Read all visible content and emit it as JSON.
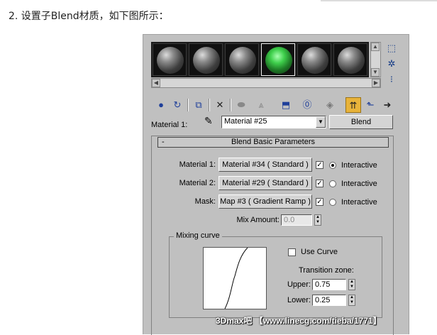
{
  "heading": "2. 设置子Blend材质，如下图所示：",
  "material_slots": [
    {
      "id": 1,
      "selected": false,
      "color": "gray"
    },
    {
      "id": 2,
      "selected": false,
      "color": "gray"
    },
    {
      "id": 3,
      "selected": false,
      "color": "gray"
    },
    {
      "id": 4,
      "selected": true,
      "color": "green"
    },
    {
      "id": 5,
      "selected": false,
      "color": "gray"
    },
    {
      "id": 6,
      "selected": false,
      "color": "gray"
    }
  ],
  "side_icons": [
    "sample-type-icon",
    "backlight-icon",
    "sample-uv-tiling-icon"
  ],
  "toolbar": {
    "buttons": [
      "get-material-icon",
      "put-material-icon",
      "assign-material-icon",
      "delete-icon",
      "copy-material-icon",
      "make-unique-icon",
      "put-to-library-icon",
      "material-id-channel-icon",
      "show-map-icon",
      "show-end-result-icon",
      "go-to-parent-icon",
      "go-forward-sibling-icon"
    ],
    "active": "show-end-result-icon"
  },
  "material_row": {
    "label": "Material 1:",
    "material_name": "Material #25",
    "type_button": "Blend"
  },
  "rollout": {
    "collapse_symbol": "-",
    "title": "Blend Basic Parameters",
    "rows": [
      {
        "label": "Material 1:",
        "button": "Material #34  ( Standard )",
        "checked": true,
        "interactive_selected": true,
        "interactive_label": "Interactive"
      },
      {
        "label": "Material 2:",
        "button": "Material #29  ( Standard )",
        "checked": true,
        "interactive_selected": false,
        "interactive_label": "Interactive"
      },
      {
        "label": "Mask:",
        "button": "Map #3  ( Gradient Ramp )",
        "checked": true,
        "interactive_selected": false,
        "interactive_label": "Interactive"
      }
    ],
    "mix_amount": {
      "label": "Mix Amount:",
      "value": "0.0"
    },
    "mixing_curve": {
      "title": "Mixing curve",
      "use_curve_label": "Use Curve",
      "use_curve_checked": false,
      "transition_label": "Transition zone:",
      "upper_label": "Upper:",
      "upper_value": "0.75",
      "lower_label": "Lower:",
      "lower_value": "0.25"
    }
  },
  "watermark": "3Dmax吧 【www.linecg.com/tieba/1771】",
  "colors": {
    "window_bg": "#c0c0c0",
    "active_button": "#e8b33a",
    "selected_sphere": "#3fd04c"
  }
}
